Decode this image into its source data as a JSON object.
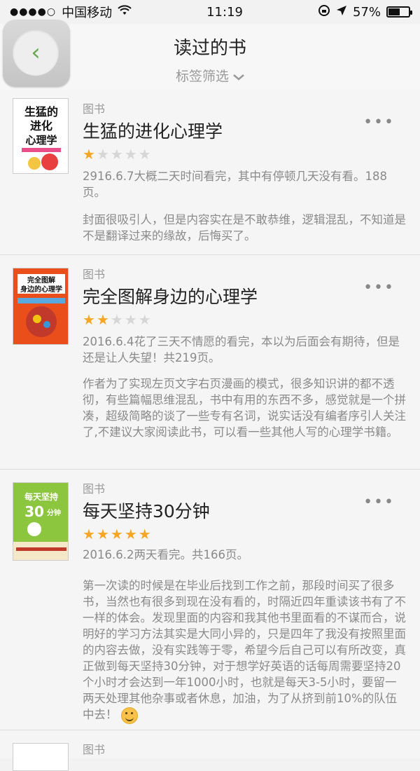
{
  "status": {
    "carrier": "中国移动",
    "time": "11:19",
    "battery_text": "57%",
    "battery_level": 0.57
  },
  "header": {
    "title": "读过的书",
    "filter_label": "标签筛选",
    "filter_icon": "chevron-down-icon"
  },
  "books": [
    {
      "category": "图书",
      "title": "生猛的进化心理学",
      "rating": 1,
      "max_rating": 5,
      "note1": "2916.6.7大概二天时间看完，其中有停顿几天没有看。188页。",
      "note2": "封面很吸引人，但是内容实在是不敢恭维，逻辑混乱，不知道是不是翻译过来的缘故，后悔买了。",
      "cover_text": "生猛的进化心理学",
      "cover_color": "#ffffff"
    },
    {
      "category": "图书",
      "title": "完全图解身边的心理学",
      "rating": 2,
      "max_rating": 5,
      "note1": "2016.6.4花了三天不情愿的看完，本以为后面会有期待，但是还是让人失望！共219页。",
      "note2": "作者为了实现左页文字右页漫画的模式，很多知识讲的都不透彻，有些篇幅思维混乱，书中有用的东西不多，感觉就是一个拼凑，超级简略的谈了一些专有名词，说实话没有编者序引人关注了,不建议大家阅读此书，可以看一些其他人写的心理学书籍。",
      "cover_text": "完全图解身边的心理学",
      "cover_color": "#e94e1b"
    },
    {
      "category": "图书",
      "title": "每天坚持30分钟",
      "rating": 5,
      "max_rating": 5,
      "note1": "2016.6.2两天看完。共166页。",
      "note2": "第一次读的时候是在毕业后找到工作之前，那段时间买了很多书，当然也有很多到现在没有看的，时隔近四年重读该书有了不一样的体会。发现里面的内容和我其他书里面看的不谋而合，说明好的学习方法其实是大同小异的，只是四年了我没有按照里面的内容去做，没有实践等于零，希望今后自己可以有所改变，真正做到每天坚持30分钟，对于想学好英语的话每周需要坚持20个小时才会达到一年1000小时，也就是每天3-5小时，要留一两天处理其他杂事或者休息，加油，为了从挤到前10%的队伍中去！",
      "cover_text": "每天坚持30分钟",
      "cover_color": "#7bbf3c"
    },
    {
      "category": "图书"
    }
  ]
}
